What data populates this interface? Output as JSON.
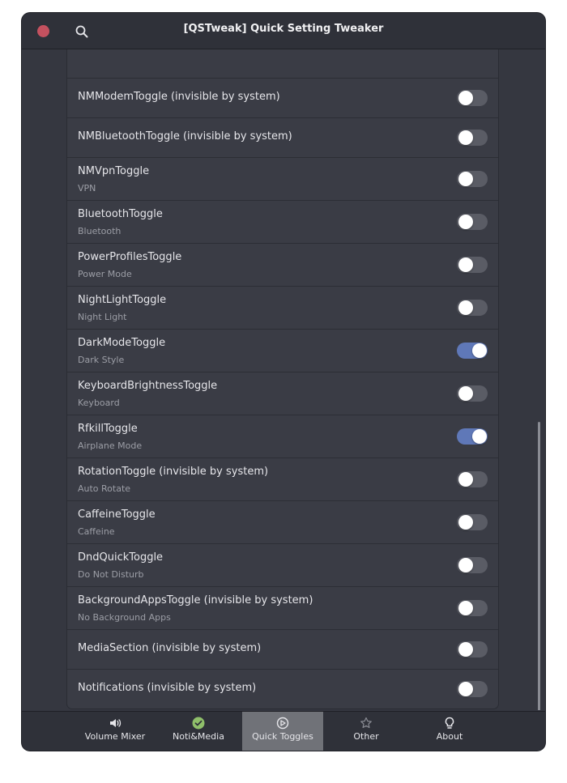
{
  "window": {
    "title": "[QSTweak] Quick Setting Tweaker"
  },
  "toggles": [
    {
      "title": "",
      "subtitle": "",
      "on": false
    },
    {
      "title": "NMModemToggle (invisible by system)",
      "subtitle": "",
      "on": false
    },
    {
      "title": "NMBluetoothToggle (invisible by system)",
      "subtitle": "",
      "on": false
    },
    {
      "title": "NMVpnToggle",
      "subtitle": "VPN",
      "on": false
    },
    {
      "title": "BluetoothToggle",
      "subtitle": "Bluetooth",
      "on": false
    },
    {
      "title": "PowerProfilesToggle",
      "subtitle": "Power Mode",
      "on": false
    },
    {
      "title": "NightLightToggle",
      "subtitle": "Night Light",
      "on": false
    },
    {
      "title": "DarkModeToggle",
      "subtitle": "Dark Style",
      "on": true
    },
    {
      "title": "KeyboardBrightnessToggle",
      "subtitle": "Keyboard",
      "on": false
    },
    {
      "title": "RfkillToggle",
      "subtitle": "Airplane Mode",
      "on": true
    },
    {
      "title": "RotationToggle (invisible by system)",
      "subtitle": "Auto Rotate",
      "on": false
    },
    {
      "title": "CaffeineToggle",
      "subtitle": "Caffeine",
      "on": false
    },
    {
      "title": "DndQuickToggle",
      "subtitle": "Do Not Disturb",
      "on": false
    },
    {
      "title": "BackgroundAppsToggle (invisible by system)",
      "subtitle": "No Background Apps",
      "on": false
    },
    {
      "title": "MediaSection (invisible by system)",
      "subtitle": "",
      "on": false
    },
    {
      "title": "Notifications (invisible by system)",
      "subtitle": "",
      "on": false
    }
  ],
  "tabs": [
    {
      "label": "Volume Mixer",
      "icon": "speaker-icon"
    },
    {
      "label": "Noti&Media",
      "icon": "check-circle-icon"
    },
    {
      "label": "Quick Toggles",
      "icon": "toggle-circle-icon",
      "active": true
    },
    {
      "label": "Other",
      "icon": "star-icon"
    },
    {
      "label": "About",
      "icon": "lightbulb-icon"
    }
  ],
  "colors": {
    "accent": "#5f78b8",
    "close": "#c4515f",
    "check": "#8fbf6a",
    "active_tab": "#707278"
  }
}
